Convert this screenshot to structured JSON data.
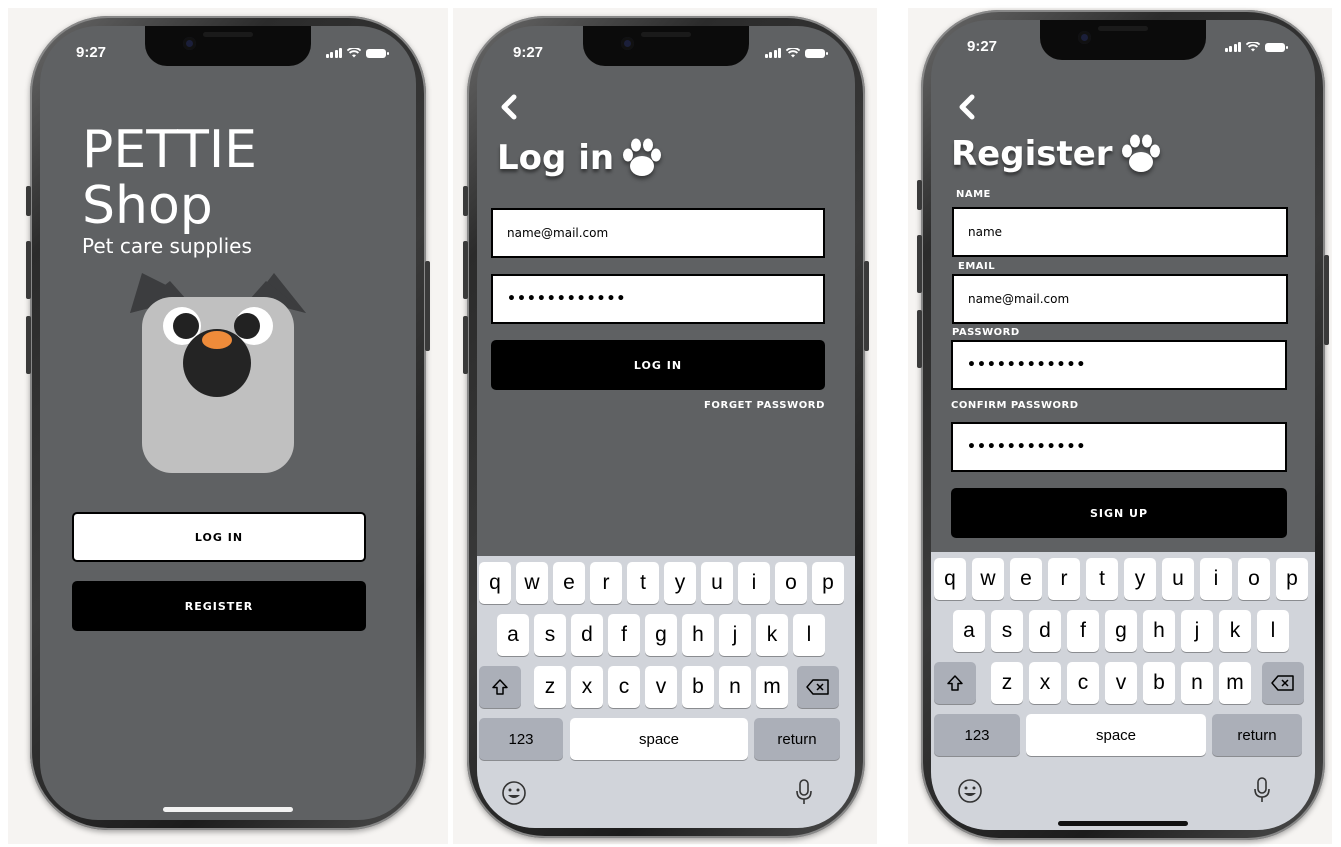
{
  "status_bar": {
    "time": "9:27"
  },
  "welcome": {
    "title_line1": "PETTIE",
    "title_line2": "Shop",
    "subtitle": "Pet care supplies",
    "login_label": "LOG IN",
    "register_label": "REGISTER"
  },
  "login": {
    "heading": "Log in",
    "email_value": "name@mail.com",
    "password_value": "••••••••••••",
    "login_label": "LOG IN",
    "forgot_label": "FORGET PASSWORD"
  },
  "register": {
    "heading": "Register",
    "name_label": "NAME",
    "name_value": "name",
    "email_label": "EMAIL",
    "email_value": "name@mail.com",
    "password_label": "PASSWORD",
    "password_value": "••••••••••••",
    "confirm_label": "CONFIRM PASSWORD",
    "confirm_value": "••••••••••••",
    "signup_label": "SIGN UP"
  },
  "keyboard": {
    "row1": [
      "q",
      "w",
      "e",
      "r",
      "t",
      "y",
      "u",
      "i",
      "o",
      "p"
    ],
    "row2": [
      "a",
      "s",
      "d",
      "f",
      "g",
      "h",
      "j",
      "k",
      "l"
    ],
    "row3": [
      "z",
      "x",
      "c",
      "v",
      "b",
      "n",
      "m"
    ],
    "numbers_label": "123",
    "space_label": "space",
    "return_label": "return"
  },
  "icons": {
    "back": "chevron-left-icon",
    "paw": "paw-icon",
    "shift": "shift-icon",
    "delete": "backspace-icon",
    "emoji": "emoji-icon",
    "mic": "microphone-icon"
  },
  "colors": {
    "screen_bg": "#5f6163",
    "keyboard_bg": "#d1d4da",
    "dog_nose": "#ee8b3a"
  }
}
